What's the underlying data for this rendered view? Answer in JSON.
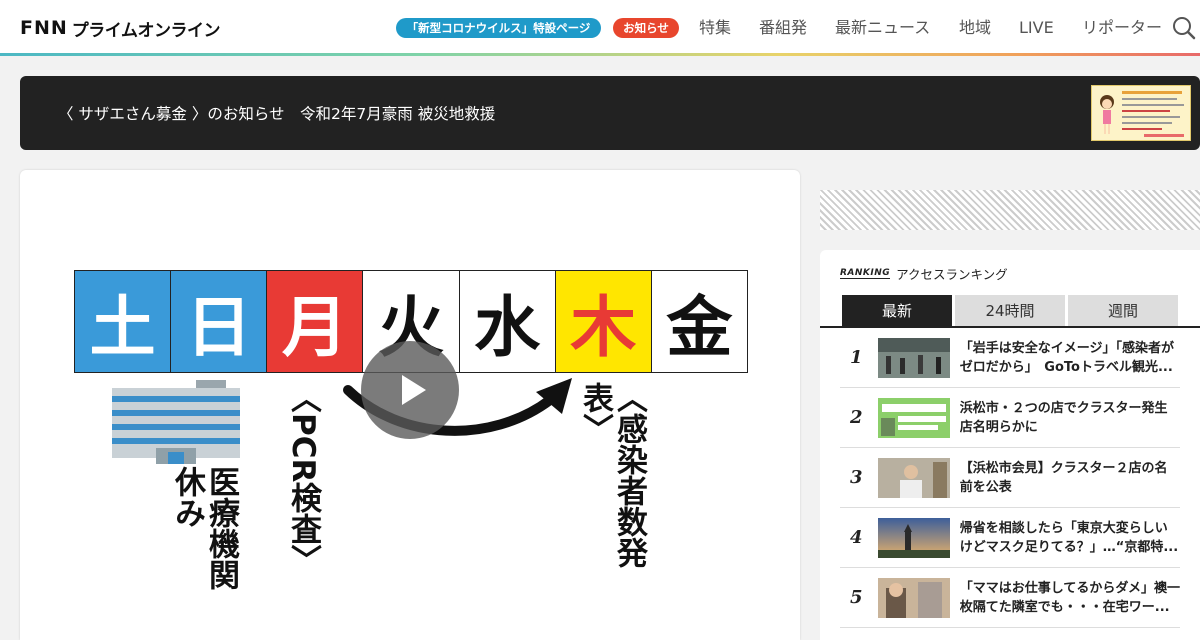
{
  "header": {
    "logo_fnn": "FNN",
    "logo_jp": "プライムオンライン",
    "corona_pill": "「新型コロナウイルス」特設ページ",
    "notice_pill": "お知らせ",
    "nav": [
      "特集",
      "番組発",
      "最新ニュース",
      "地域",
      "LIVE",
      "リポーター"
    ]
  },
  "banner": {
    "text": "〈 サザエさん募金 〉のお知らせ　令和2年7月豪雨 被災地救援"
  },
  "video": {
    "days": [
      "土",
      "日",
      "月",
      "火",
      "水",
      "木",
      "金"
    ],
    "caption_left": "医療機関休み",
    "caption_pcr": "〈PCR検査〉",
    "caption_right": "〈感染者数発表〉"
  },
  "ranking": {
    "label_en": "RANKING",
    "label_jp": "アクセスランキング",
    "tabs": [
      "最新",
      "24時間",
      "週間"
    ],
    "items": [
      {
        "rank": "1",
        "title": "「岩手は安全なイメージ」「感染者がゼロだから」　GoToトラベル観光..."
      },
      {
        "rank": "2",
        "title": "浜松市・２つの店でクラスター発生 店名明らかに"
      },
      {
        "rank": "3",
        "title": "【浜松市会見】クラスター２店の名前を公表"
      },
      {
        "rank": "4",
        "title": "帰省を相談したら「東京大変らしいけどマスク足りてる？」…“京都特..."
      },
      {
        "rank": "5",
        "title": "「ママはお仕事してるからダメ」襖一枚隔てた隣室でも・・・在宅ワー..."
      }
    ]
  },
  "colors": {
    "corona": "#1f9ac9",
    "notice": "#e8462d",
    "day_sat": "#3a9ad9",
    "day_sun": "#3a9ad9",
    "day_mon": "#e83a35",
    "day_thu": "#ffe600"
  }
}
